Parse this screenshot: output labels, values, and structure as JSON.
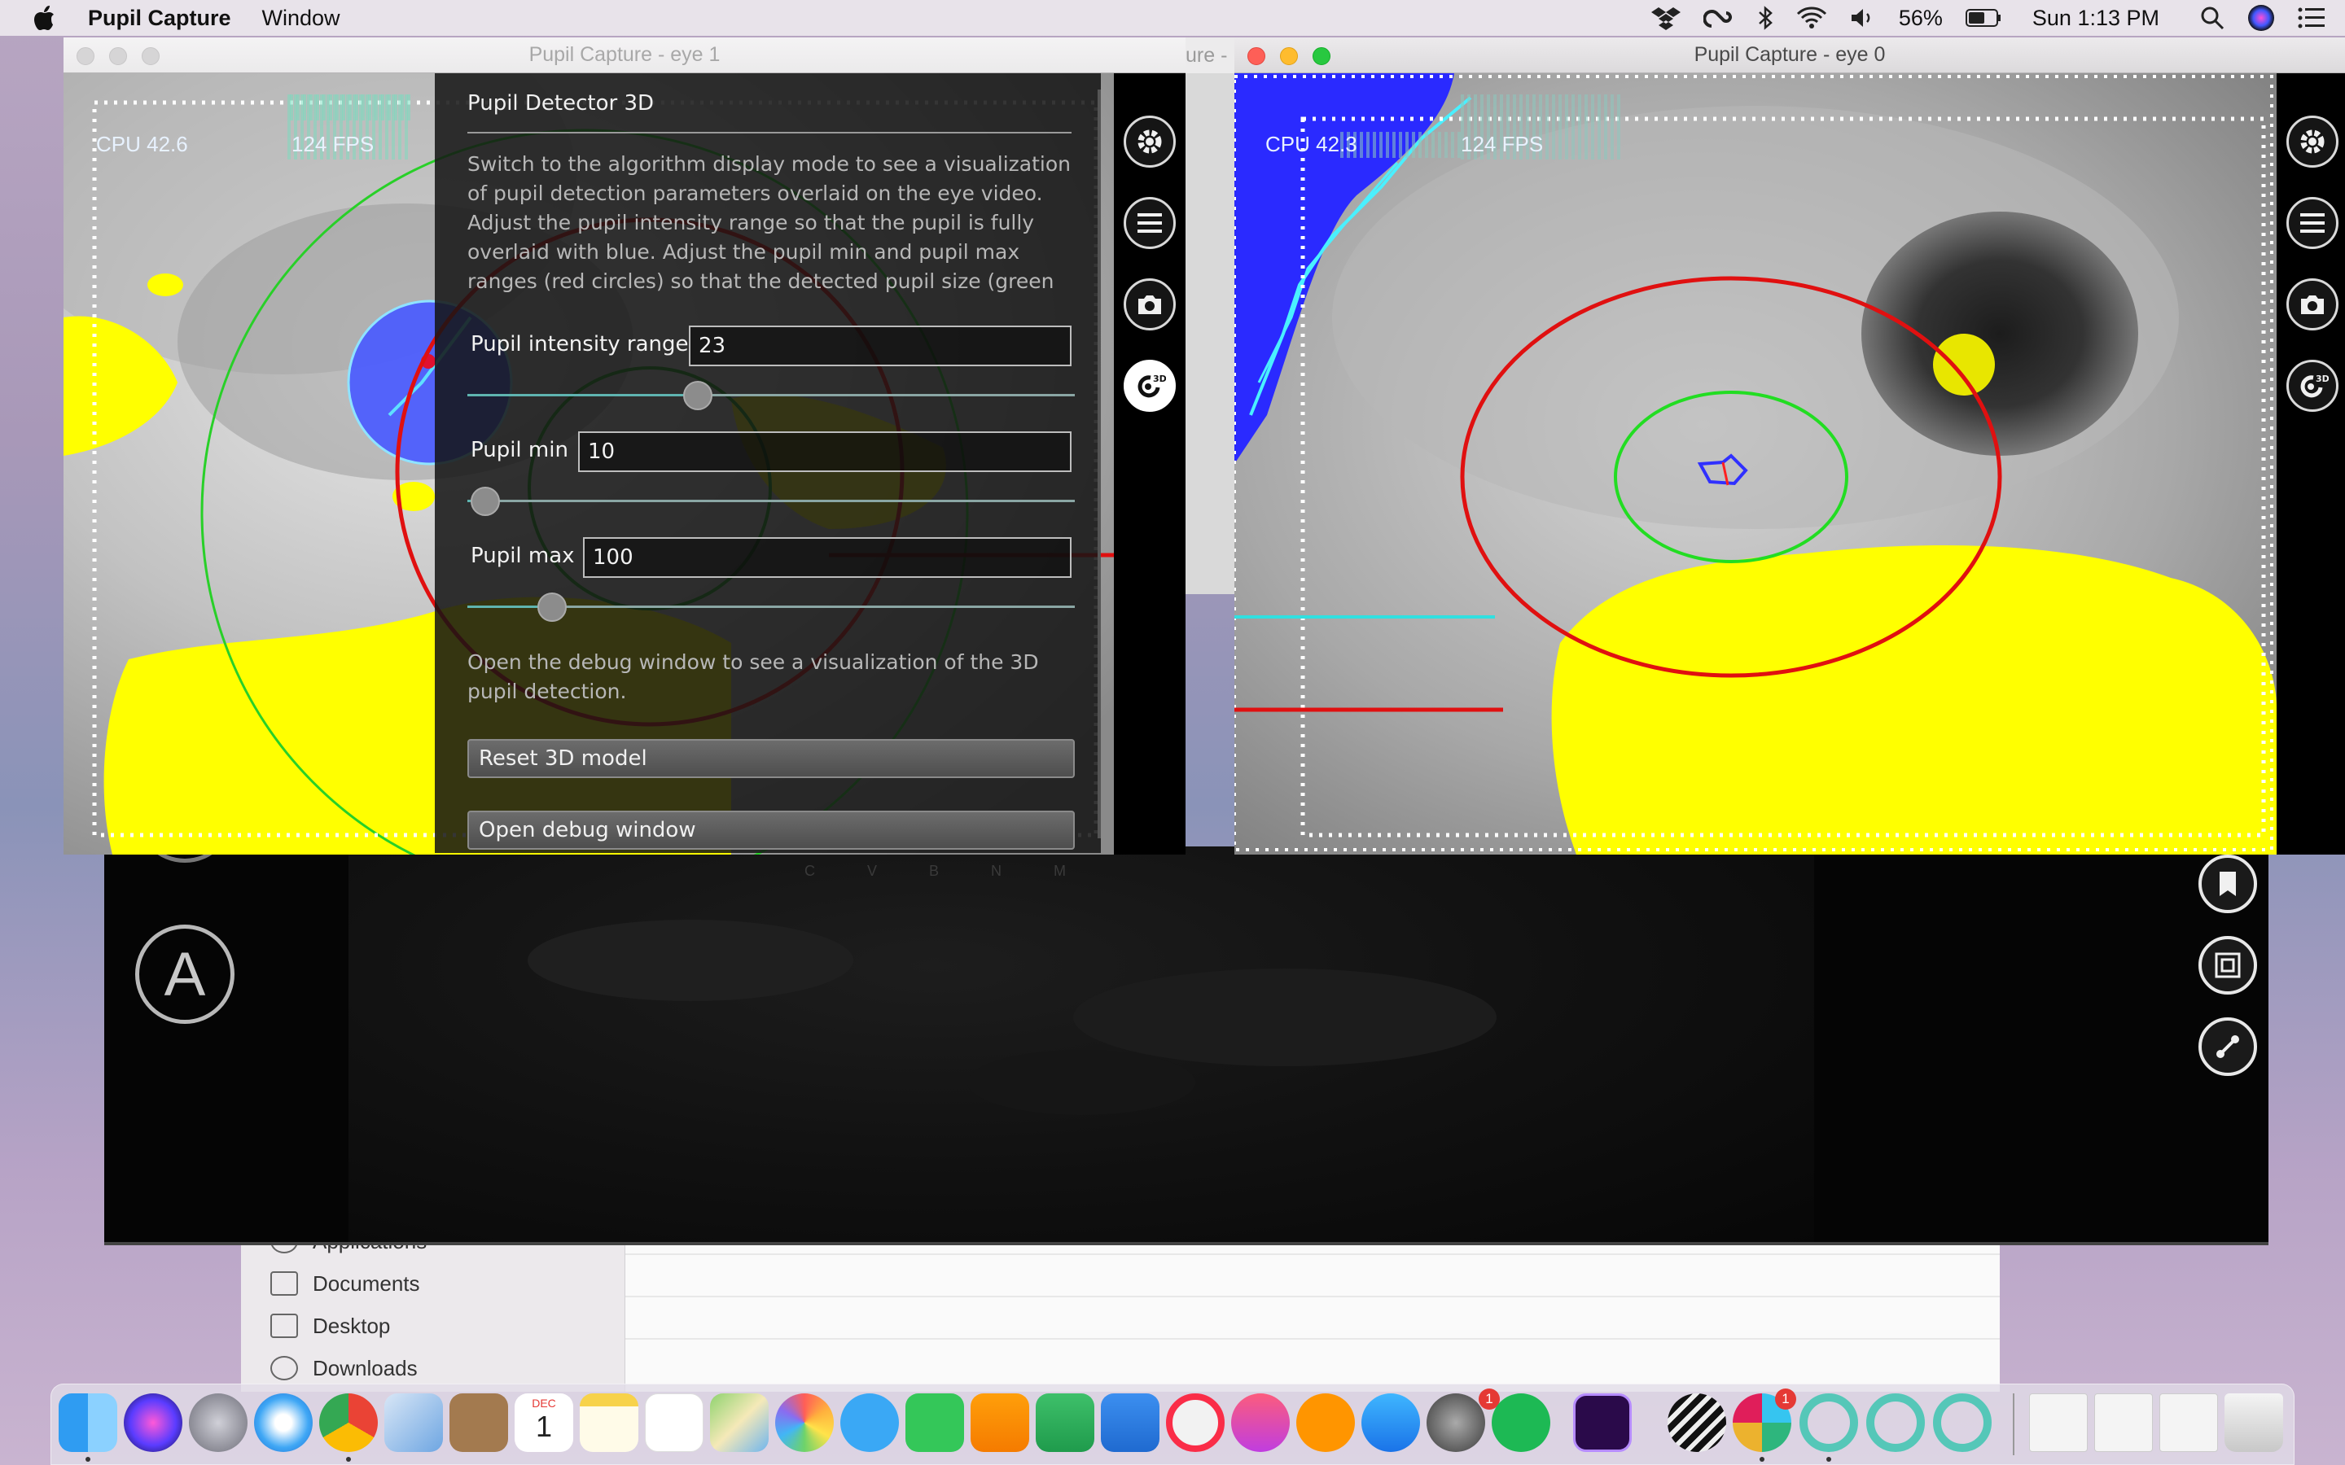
{
  "menubar": {
    "app_name": "Pupil Capture",
    "menus": [
      "Window"
    ],
    "battery": "56%",
    "clock": "Sun 1:13 PM"
  },
  "finder": {
    "items": [
      {
        "label": "Applications",
        "icon": "applications-icon"
      },
      {
        "label": "Documents",
        "icon": "documents-icon"
      },
      {
        "label": "Desktop",
        "icon": "desktop-icon"
      },
      {
        "label": "Downloads",
        "icon": "downloads-icon"
      }
    ]
  },
  "world": {
    "auto_button_label": "A",
    "behind_title_fragment": "ure -"
  },
  "eye1": {
    "title": "Pupil Capture - eye 1",
    "cpu": "CPU 42.6",
    "fps": "124 FPS"
  },
  "eye0": {
    "title": "Pupil Capture - eye 0",
    "cpu": "CPU 42.3",
    "fps": "124 FPS"
  },
  "panel": {
    "title": "Pupil Detector 3D",
    "description": "Switch to the algorithm display mode to see a visualization of pupil detection parameters overlaid on the eye video. Adjust the pupil intensity range so that the pupil is fully overlaid with blue. Adjust the pupil min and pupil max ranges (red circles) so that the detected pupil size (green",
    "intensity_label": "Pupil intensity range",
    "intensity_value": "23",
    "intensity_fraction": 0.38,
    "min_label": "Pupil min",
    "min_value": "10",
    "min_fraction": 0.03,
    "max_label": "Pupil max",
    "max_value": "100",
    "max_fraction": 0.14,
    "debug_hint": "Open the debug window to see a visualization of the 3D pupil detection.",
    "reset_label": "Reset 3D model",
    "debug_label": "Open debug window"
  },
  "side_icons": [
    "gear-icon",
    "menu-list-icon",
    "camera-icon",
    "3d-detector-icon"
  ],
  "side_icon_3d_label": "3D",
  "dock": {
    "calendar_month": "DEC",
    "calendar_day": "1",
    "badge_settings": "1",
    "badge_slack": "1"
  },
  "colors": {
    "detect_yellow": "#ffff00",
    "pupil_blue": "#3333ff",
    "max_circle_red": "#e01010",
    "min_circle_green": "#22dd22"
  }
}
